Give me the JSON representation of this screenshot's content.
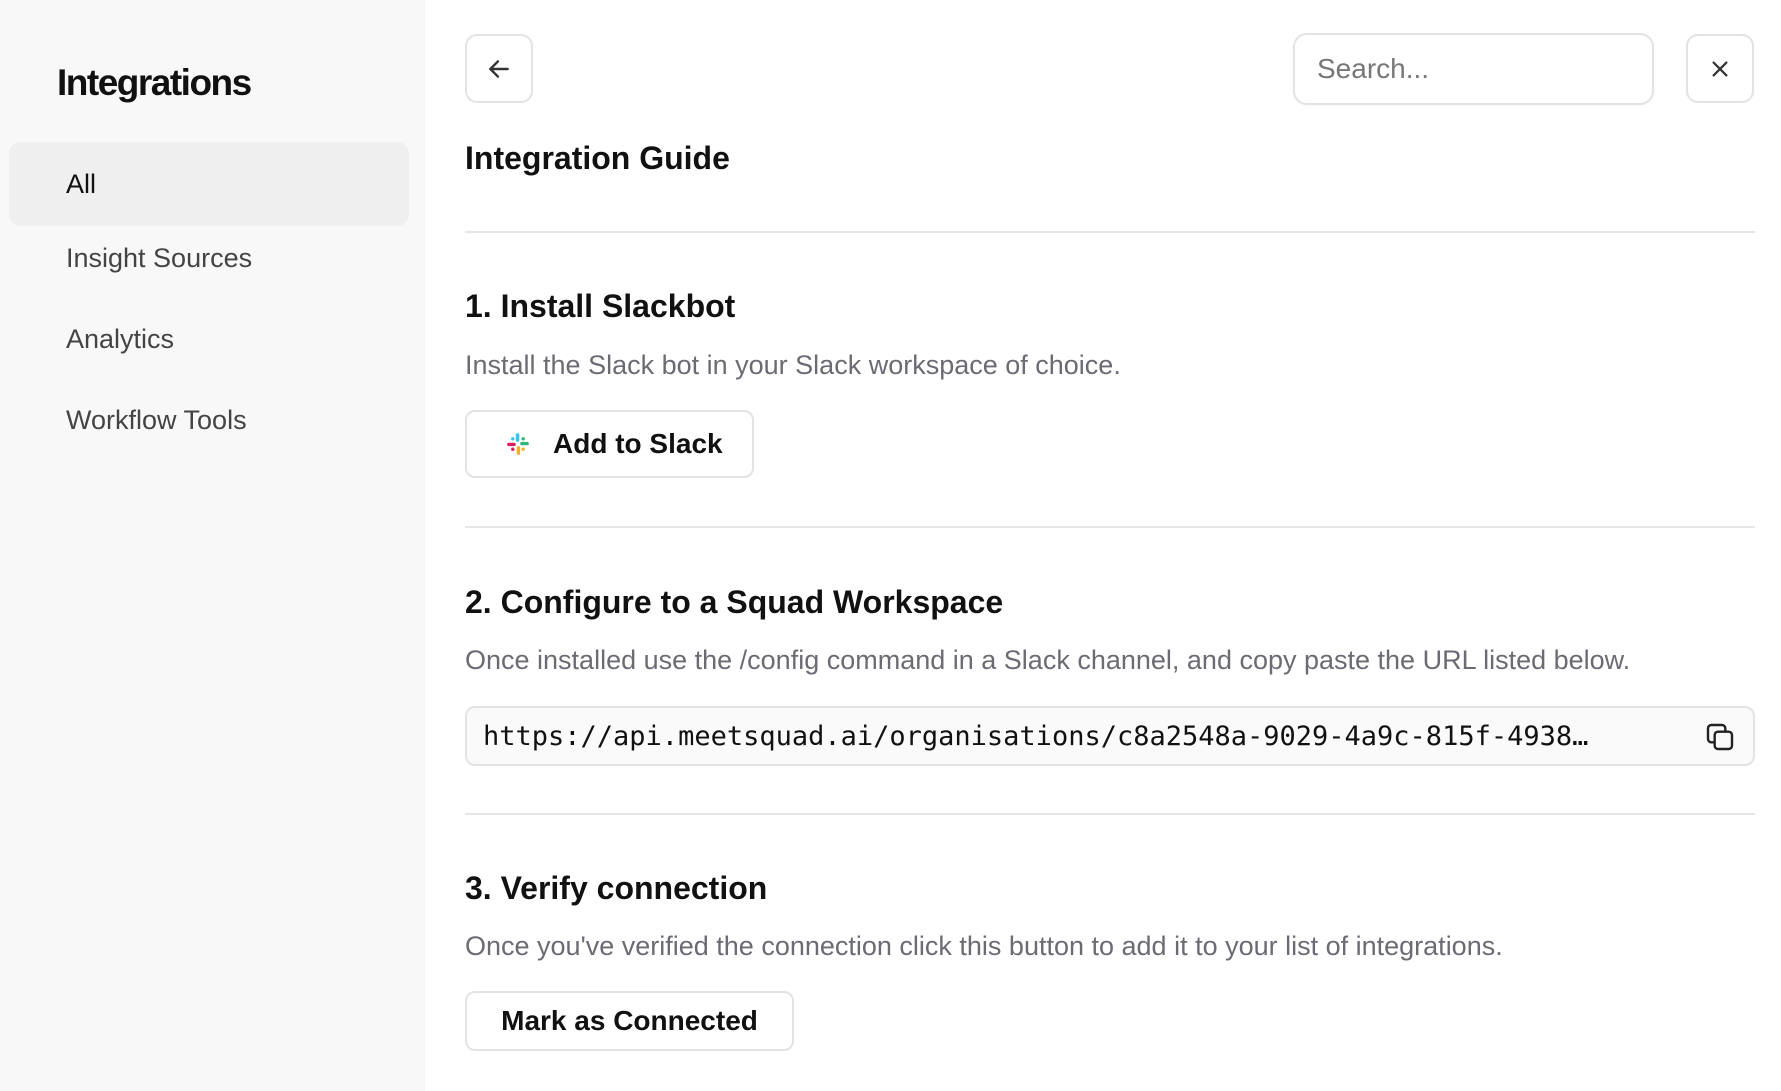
{
  "sidebar": {
    "title": "Integrations",
    "items": [
      {
        "label": "All",
        "active": true
      },
      {
        "label": "Insight Sources",
        "active": false
      },
      {
        "label": "Analytics",
        "active": false
      },
      {
        "label": "Workflow Tools",
        "active": false
      }
    ]
  },
  "header": {
    "back_icon": "arrow-left-icon",
    "search_placeholder": "Search...",
    "close_icon": "close-icon"
  },
  "main": {
    "title": "Integration Guide",
    "steps": [
      {
        "title": "1. Install Slackbot",
        "description": "Install the Slack bot in your Slack workspace of choice.",
        "button_label": "Add to Slack",
        "button_icon": "slack-icon"
      },
      {
        "title": "2. Configure to a Squad Workspace",
        "description": "Once installed use the /config command in a Slack channel, and copy paste the URL listed below.",
        "url": "https://api.meetsquad.ai/organisations/c8a2548a-9029-4a9c-815f-4938…",
        "copy_icon": "copy-icon"
      },
      {
        "title": "3. Verify connection",
        "description": "Once you've verified the connection click this button to add it to your list of integrations.",
        "button_label": "Mark as Connected"
      }
    ]
  },
  "colors": {
    "sidebar_bg": "#f8f8f8",
    "active_item_bg": "#efefef",
    "border": "#e3e3e3",
    "muted_text": "#6b6b73",
    "slack_blue": "#36C5F0",
    "slack_green": "#2EB67D",
    "slack_yellow": "#ECB22E",
    "slack_red": "#E01E5A"
  }
}
